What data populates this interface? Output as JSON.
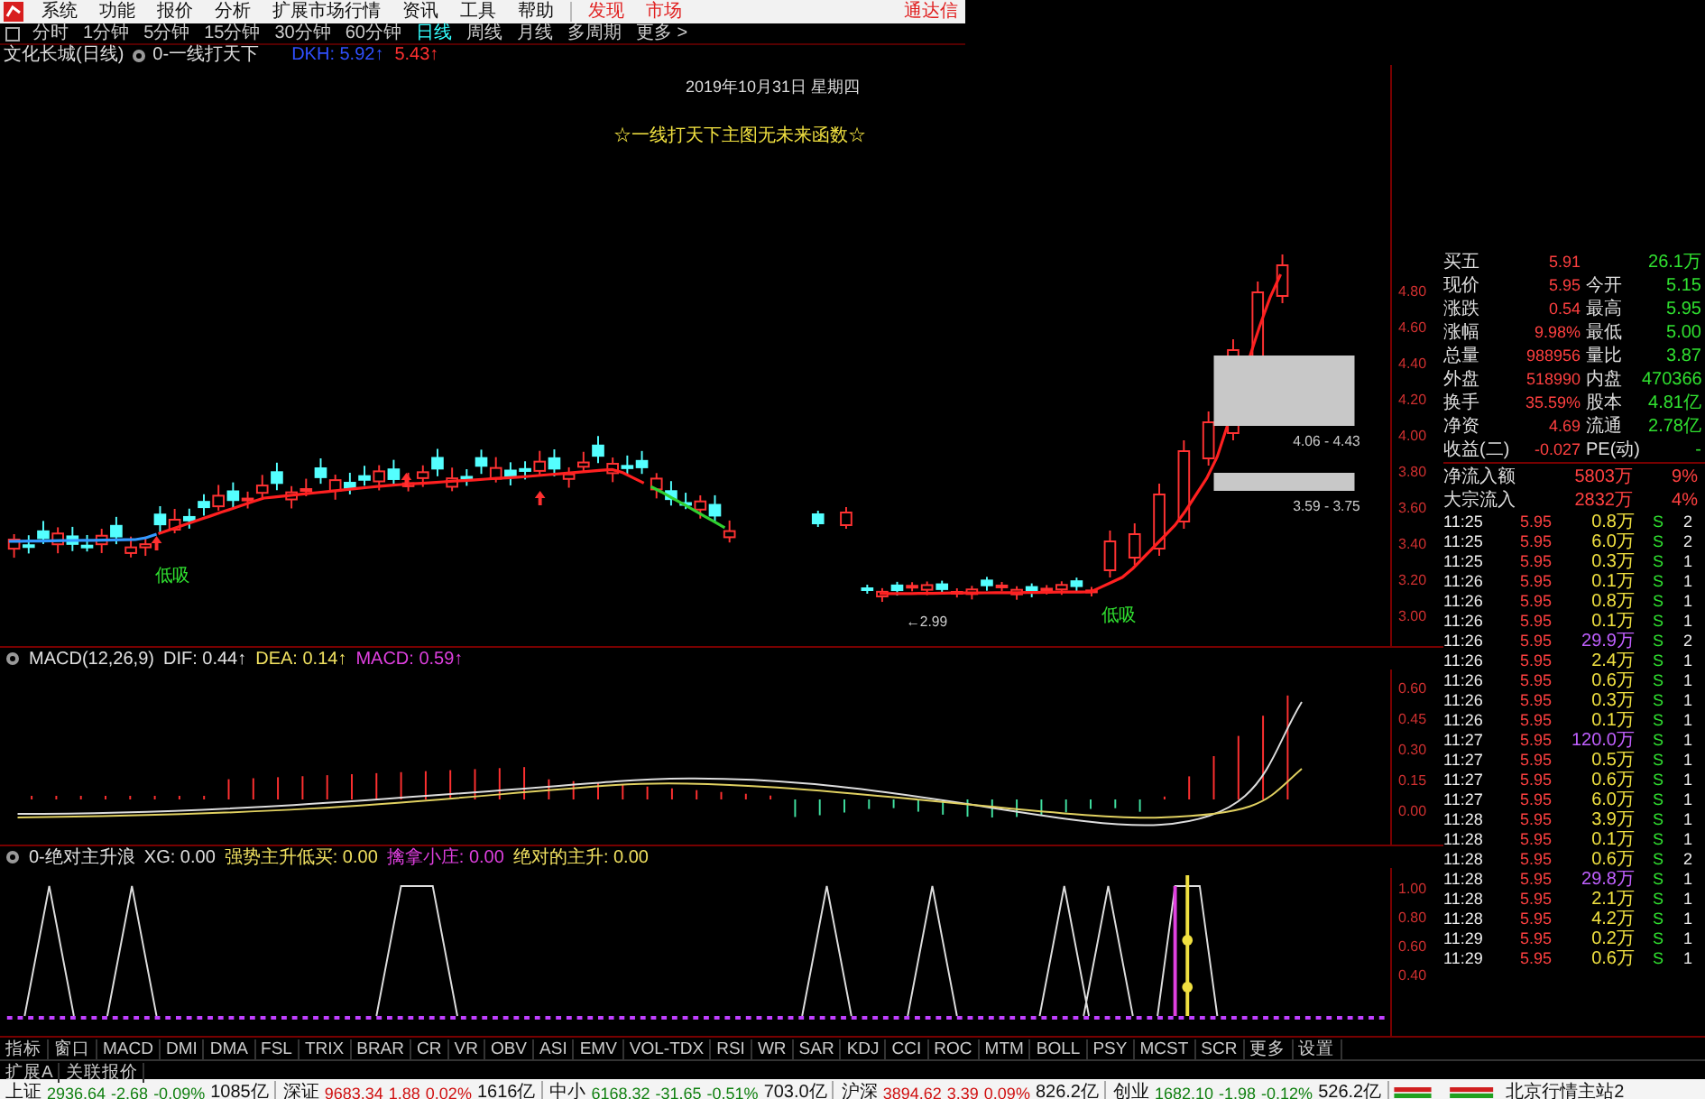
{
  "menubar": {
    "items": [
      {
        "label": "系统",
        "kind": "normal"
      },
      {
        "label": "功能",
        "kind": "normal"
      },
      {
        "label": "报价",
        "kind": "normal"
      },
      {
        "label": "分析",
        "kind": "normal"
      },
      {
        "label": "扩展市场行情",
        "kind": "normal"
      },
      {
        "label": "资讯",
        "kind": "normal"
      },
      {
        "label": "工具",
        "kind": "normal"
      },
      {
        "label": "帮助",
        "kind": "normal"
      },
      {
        "label": "发现",
        "kind": "highlight"
      },
      {
        "label": "市场",
        "kind": "highlight"
      }
    ],
    "right_label": "通达信"
  },
  "periods": [
    {
      "label": "分时",
      "selected": false
    },
    {
      "label": "1分钟",
      "selected": false
    },
    {
      "label": "5分钟",
      "selected": false
    },
    {
      "label": "15分钟",
      "selected": false
    },
    {
      "label": "30分钟",
      "selected": false
    },
    {
      "label": "60分钟",
      "selected": false
    },
    {
      "label": "日线",
      "selected": true
    },
    {
      "label": "周线",
      "selected": false
    },
    {
      "label": "月线",
      "selected": false
    },
    {
      "label": "多周期",
      "selected": false
    },
    {
      "label": "更多 >",
      "selected": false
    }
  ],
  "chart_title": {
    "stock": "文化长城(日线)",
    "indicator": "0-一线打天下",
    "values": [
      {
        "text": "DKH: 5.92↑",
        "color": "#3050ff"
      },
      {
        "text": "5.43↑",
        "color": "#ff3030"
      }
    ]
  },
  "main_chart": {
    "date": "2019年10月31日 星期四",
    "banner": "☆一线打天下主图无未来函数☆",
    "zones": [
      "4.06 - 4.43",
      "3.59 - 3.75"
    ],
    "low_marker": "←2.99",
    "signals": [
      "低吸",
      "低吸"
    ],
    "y_axis_labels": [
      "4.80",
      "4.60",
      "4.40",
      "4.20",
      "4.00",
      "3.80",
      "3.60",
      "3.40",
      "3.20",
      "3.00"
    ]
  },
  "macd": {
    "items": [
      {
        "text": "MACD(12,26,9)",
        "color": "#e0e0e0"
      },
      {
        "text": "DIF: 0.44↑",
        "color": "#e0e0e0"
      },
      {
        "text": "DEA: 0.14↑",
        "color": "#f0e060"
      },
      {
        "text": "MACD: 0.59↑",
        "color": "#e040e0"
      }
    ],
    "y_axis_labels": [
      "0.60",
      "0.45",
      "0.30",
      "0.15",
      "0.00"
    ]
  },
  "indicator": {
    "items": [
      {
        "text": "0-绝对主升浪",
        "color": "#e0e0e0"
      },
      {
        "text": "XG: 0.00",
        "color": "#e0e0e0"
      },
      {
        "text": "强势主升低买: 0.00",
        "color": "#f0e060"
      },
      {
        "text": "擒拿小庄: 0.00",
        "color": "#e040e0"
      },
      {
        "text": "绝对的主升: 0.00",
        "color": "#f0e060"
      }
    ],
    "y_axis_labels": [
      "1.00",
      "0.80",
      "0.60",
      "0.40"
    ]
  },
  "quote": {
    "summary": [
      {
        "label": "买五",
        "value": "5.91",
        "value2": "26.1万"
      },
      {
        "label": "现价",
        "value": "5.95",
        "label2": "今开",
        "value2": "5.15"
      },
      {
        "label": "涨跌",
        "value": "0.54",
        "label2": "最高",
        "value2": "5.95"
      },
      {
        "label": "涨幅",
        "value": "9.98%",
        "label2": "最低",
        "value2": "5.00"
      },
      {
        "label": "总量",
        "value": "988956",
        "label2": "量比",
        "value2": "3.87"
      },
      {
        "label": "外盘",
        "value": "518990",
        "label2": "内盘",
        "value2": "470366"
      },
      {
        "label": "换手",
        "value": "35.59%",
        "label2": "股本",
        "value2": "4.81亿"
      },
      {
        "label": "净资",
        "value": "4.69",
        "label2": "流通",
        "value2": "2.78亿"
      },
      {
        "label": "收益(二)",
        "value": "-0.027",
        "label2": "PE(动)",
        "value2": "-"
      }
    ],
    "flows": [
      {
        "label": "净流入额",
        "value": "5803万",
        "share": "9%"
      },
      {
        "label": "大宗流入",
        "value": "2832万",
        "share": "4%"
      }
    ],
    "ticks": [
      {
        "time": "11:25",
        "price": "5.95",
        "volume": "0.8万",
        "side": "S",
        "count": "2",
        "kind": "normal"
      },
      {
        "time": "11:25",
        "price": "5.95",
        "volume": "6.0万",
        "side": "S",
        "count": "2",
        "kind": "normal"
      },
      {
        "time": "11:25",
        "price": "5.95",
        "volume": "0.3万",
        "side": "S",
        "count": "1",
        "kind": "normal"
      },
      {
        "time": "11:26",
        "price": "5.95",
        "volume": "0.1万",
        "side": "S",
        "count": "1",
        "kind": "normal"
      },
      {
        "time": "11:26",
        "price": "5.95",
        "volume": "0.8万",
        "side": "S",
        "count": "1",
        "kind": "normal"
      },
      {
        "time": "11:26",
        "price": "5.95",
        "volume": "0.1万",
        "side": "S",
        "count": "1",
        "kind": "normal"
      },
      {
        "time": "11:26",
        "price": "5.95",
        "volume": "29.9万",
        "side": "S",
        "count": "2",
        "kind": "large"
      },
      {
        "time": "11:26",
        "price": "5.95",
        "volume": "2.4万",
        "side": "S",
        "count": "1",
        "kind": "normal"
      },
      {
        "time": "11:26",
        "price": "5.95",
        "volume": "0.6万",
        "side": "S",
        "count": "1",
        "kind": "normal"
      },
      {
        "time": "11:26",
        "price": "5.95",
        "volume": "0.3万",
        "side": "S",
        "count": "1",
        "kind": "normal"
      },
      {
        "time": "11:26",
        "price": "5.95",
        "volume": "0.1万",
        "side": "S",
        "count": "1",
        "kind": "normal"
      },
      {
        "time": "11:27",
        "price": "5.95",
        "volume": "120.0万",
        "side": "S",
        "count": "1",
        "kind": "large"
      },
      {
        "time": "11:27",
        "price": "5.95",
        "volume": "0.5万",
        "side": "S",
        "count": "1",
        "kind": "normal"
      },
      {
        "time": "11:27",
        "price": "5.95",
        "volume": "0.6万",
        "side": "S",
        "count": "1",
        "kind": "normal"
      },
      {
        "time": "11:27",
        "price": "5.95",
        "volume": "6.0万",
        "side": "S",
        "count": "1",
        "kind": "normal"
      },
      {
        "time": "11:28",
        "price": "5.95",
        "volume": "3.9万",
        "side": "S",
        "count": "1",
        "kind": "normal"
      },
      {
        "time": "11:28",
        "price": "5.95",
        "volume": "0.1万",
        "side": "S",
        "count": "1",
        "kind": "normal"
      },
      {
        "time": "11:28",
        "price": "5.95",
        "volume": "0.6万",
        "side": "S",
        "count": "2",
        "kind": "normal"
      },
      {
        "time": "11:28",
        "price": "5.95",
        "volume": "29.8万",
        "side": "S",
        "count": "1",
        "kind": "large"
      },
      {
        "time": "11:28",
        "price": "5.95",
        "volume": "2.1万",
        "side": "S",
        "count": "1",
        "kind": "normal"
      },
      {
        "time": "11:28",
        "price": "5.95",
        "volume": "4.2万",
        "side": "S",
        "count": "1",
        "kind": "normal"
      },
      {
        "time": "11:29",
        "price": "5.95",
        "volume": "0.2万",
        "side": "S",
        "count": "1",
        "kind": "normal"
      },
      {
        "time": "11:29",
        "price": "5.95",
        "volume": "0.6万",
        "side": "S",
        "count": "1",
        "kind": "normal"
      }
    ]
  },
  "indicator_tabs": [
    "指标",
    "窗口",
    "MACD",
    "DMI",
    "DMA",
    "FSL",
    "TRIX",
    "BRAR",
    "CR",
    "VR",
    "OBV",
    "ASI",
    "EMV",
    "VOL-TDX",
    "RSI",
    "WR",
    "SAR",
    "KDJ",
    "CCI",
    "ROC",
    "MTM",
    "BOLL",
    "PSY",
    "MCST",
    "SCR",
    "更多",
    "设置"
  ],
  "sub_tabs": [
    "扩展A",
    "关联报价"
  ],
  "status_bar": {
    "indices": [
      {
        "name": "上证",
        "value": "2936.64",
        "change": "-2.68",
        "percent": "-0.09%",
        "amount": "1085亿",
        "color": "#108010"
      },
      {
        "name": "深证",
        "value": "9683.34",
        "change": "1.88",
        "percent": "0.02%",
        "amount": "1616亿",
        "color": "#d01010"
      },
      {
        "name": "中小",
        "value": "6168.32",
        "change": "-31.65",
        "percent": "-0.51%",
        "amount": "703.0亿",
        "color": "#108010"
      },
      {
        "name": "沪深",
        "value": "3894.62",
        "change": "3.39",
        "percent": "0.09%",
        "amount": "826.2亿",
        "color": "#d01010"
      },
      {
        "name": "创业",
        "value": "1682.10",
        "change": "-1.98",
        "percent": "-0.12%",
        "amount": "526.2亿",
        "color": "#108010"
      }
    ],
    "server": "北京行情主站2"
  }
}
